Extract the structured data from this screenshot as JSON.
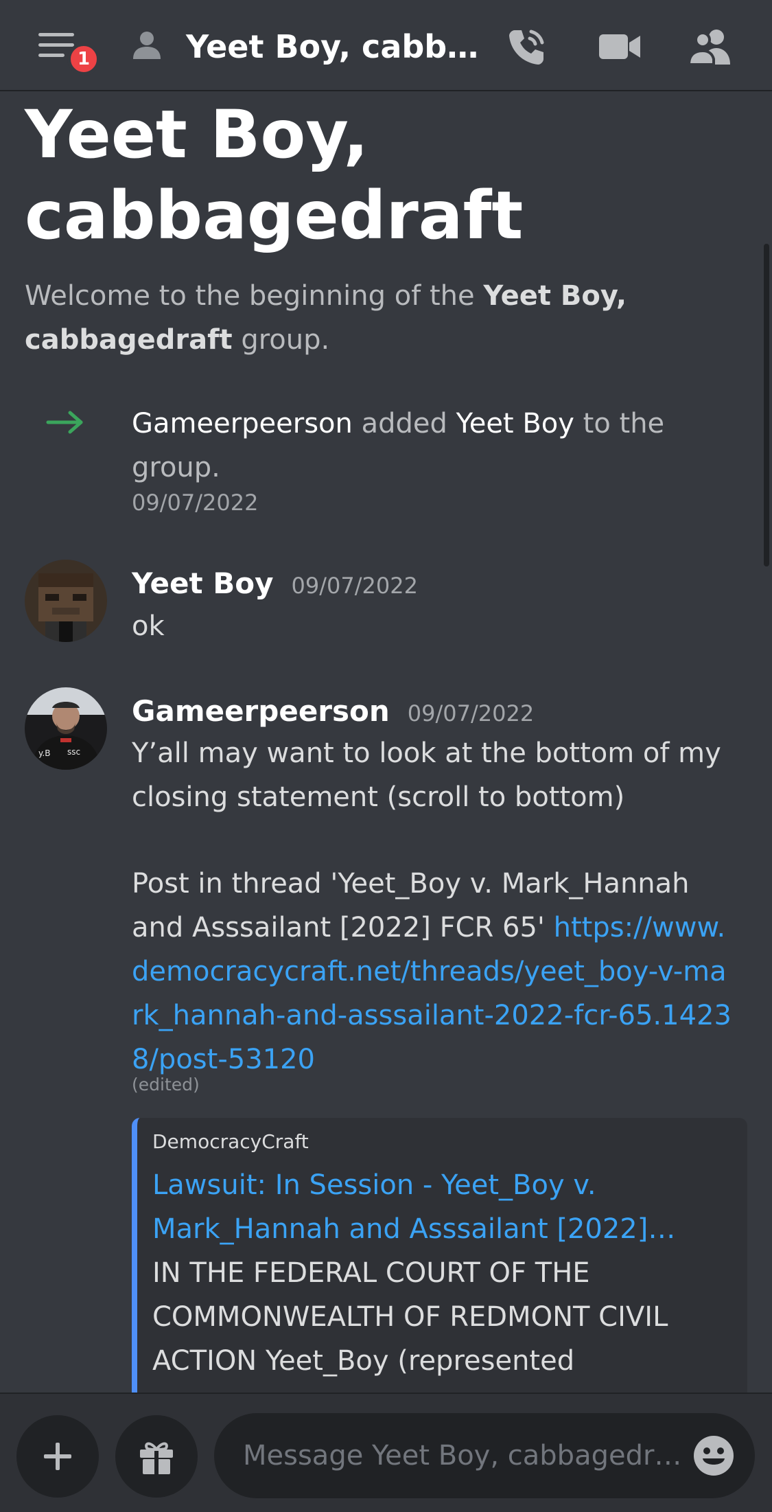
{
  "header": {
    "title": "Yeet Boy, cabb…",
    "badge_count": "1"
  },
  "channel": {
    "title": "Yeet Boy, cabbagedraft",
    "welcome_prefix": "Welcome to the beginning of the ",
    "welcome_name": "Yeet Boy, cabbagedraft",
    "welcome_suffix": " group."
  },
  "system_message": {
    "actor": "Gameerpeerson",
    "action": " added ",
    "target": "Yeet Boy",
    "suffix": " to the group.",
    "time": "09/07/2022"
  },
  "messages": [
    {
      "author": "Yeet Boy",
      "time": "09/07/2022",
      "text": "ok"
    },
    {
      "author": "Gameerpeerson",
      "time": "09/07/2022",
      "text_1": "Y’all may want to look at the bottom of my closing statement (scroll to bottom)",
      "text_2": "Post in thread 'Yeet_Boy v. Mark_Hannah and Asssailant [2022] FCR 65' ",
      "link": "https://www.democracycraft.net/threads/yeet_boy-v-mark_hannah-and-asssailant-2022-fcr-65.14238/post-53120",
      "edited": "(edited)",
      "embed": {
        "provider": "DemocracyCraft",
        "title": "Lawsuit: In Session - Yeet_Boy v. Mark_Hannah and Asssailant [2022]…",
        "description": "IN THE FEDERAL COURT OF THE COMMONWEALTH OF REDMONT CIVIL ACTION Yeet_Boy (represented"
      }
    }
  ],
  "composer": {
    "placeholder": "Message Yeet Boy, cabbagedr…"
  },
  "colors": {
    "background": "#36393f",
    "link": "#3ba3f5",
    "badge": "#ed4245",
    "system_arrow": "#3ba55c",
    "embed_accent": "#4f8ff7"
  },
  "icons": [
    "hamburger-menu-icon",
    "dm-person-icon",
    "voice-call-icon",
    "video-call-icon",
    "members-icon",
    "arrow-right-icon",
    "plus-icon",
    "gift-icon",
    "emoji-icon"
  ]
}
